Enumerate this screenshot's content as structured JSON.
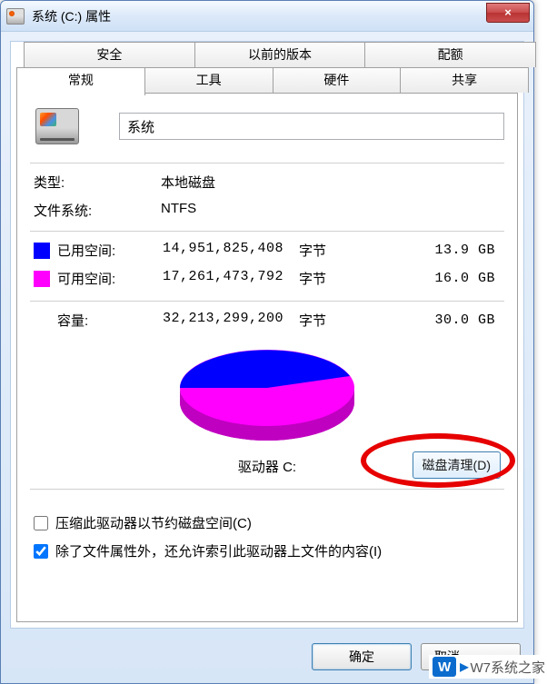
{
  "window": {
    "title": "系统 (C:) 属性",
    "close_label": "×"
  },
  "tabs": {
    "back": [
      {
        "label": "安全"
      },
      {
        "label": "以前的版本"
      },
      {
        "label": "配额"
      }
    ],
    "front": [
      {
        "label": "常规",
        "active": true
      },
      {
        "label": "工具"
      },
      {
        "label": "硬件"
      },
      {
        "label": "共享"
      }
    ]
  },
  "general": {
    "volume_name": "系统",
    "type_label": "类型:",
    "type_value": "本地磁盘",
    "fs_label": "文件系统:",
    "fs_value": "NTFS",
    "used_label": "已用空间:",
    "used_bytes": "14,951,825,408",
    "used_unit": "字节",
    "used_gb": "13.9 GB",
    "free_label": "可用空间:",
    "free_bytes": "17,261,473,792",
    "free_unit": "字节",
    "free_gb": "16.0 GB",
    "capacity_label": "容量:",
    "capacity_bytes": "32,213,299,200",
    "capacity_unit": "字节",
    "capacity_gb": "30.0 GB",
    "drive_label": "驱动器 C:",
    "cleanup_button": "磁盘清理(D)",
    "compress_checkbox": "压缩此驱动器以节约磁盘空间(C)",
    "index_checkbox": "除了文件属性外，还允许索引此驱动器上文件的内容(I)",
    "index_checked": true,
    "compress_checked": false
  },
  "chart_data": {
    "type": "pie",
    "title": "驱动器 C:",
    "series": [
      {
        "name": "已用空间",
        "value": 14951825408,
        "display": "13.9 GB",
        "color": "#0000ff"
      },
      {
        "name": "可用空间",
        "value": 17261473792,
        "display": "16.0 GB",
        "color": "#ff00ff"
      }
    ],
    "total": 32213299200,
    "total_display": "30.0 GB"
  },
  "footer": {
    "ok": "确定",
    "cancel": "取消"
  },
  "watermark": {
    "badge": "W",
    "text": "W7系统之家"
  }
}
